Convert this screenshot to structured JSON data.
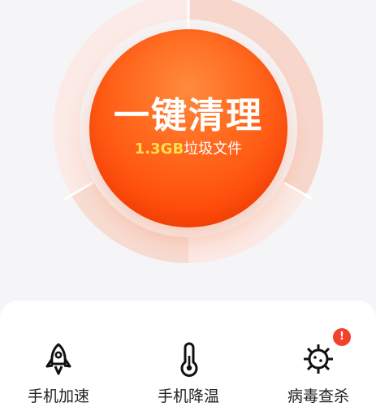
{
  "cleaner": {
    "action_label": "一键清理",
    "junk_size": "1.3GB",
    "junk_label": "垃圾文件",
    "ring_colors": {
      "outer_light": "#fbeae6",
      "outer_mid": "#f7d6cc",
      "orb": "#ff5a14"
    }
  },
  "tools": [
    {
      "label": "手机加速",
      "icon": "rocket-icon"
    },
    {
      "label": "手机降温",
      "icon": "thermometer-icon"
    },
    {
      "label": "病毒查杀",
      "icon": "virus-icon",
      "badge": "!"
    }
  ],
  "colors": {
    "accent": "#ff5a14",
    "highlight": "#ffe04a",
    "badge": "#f5412a"
  }
}
